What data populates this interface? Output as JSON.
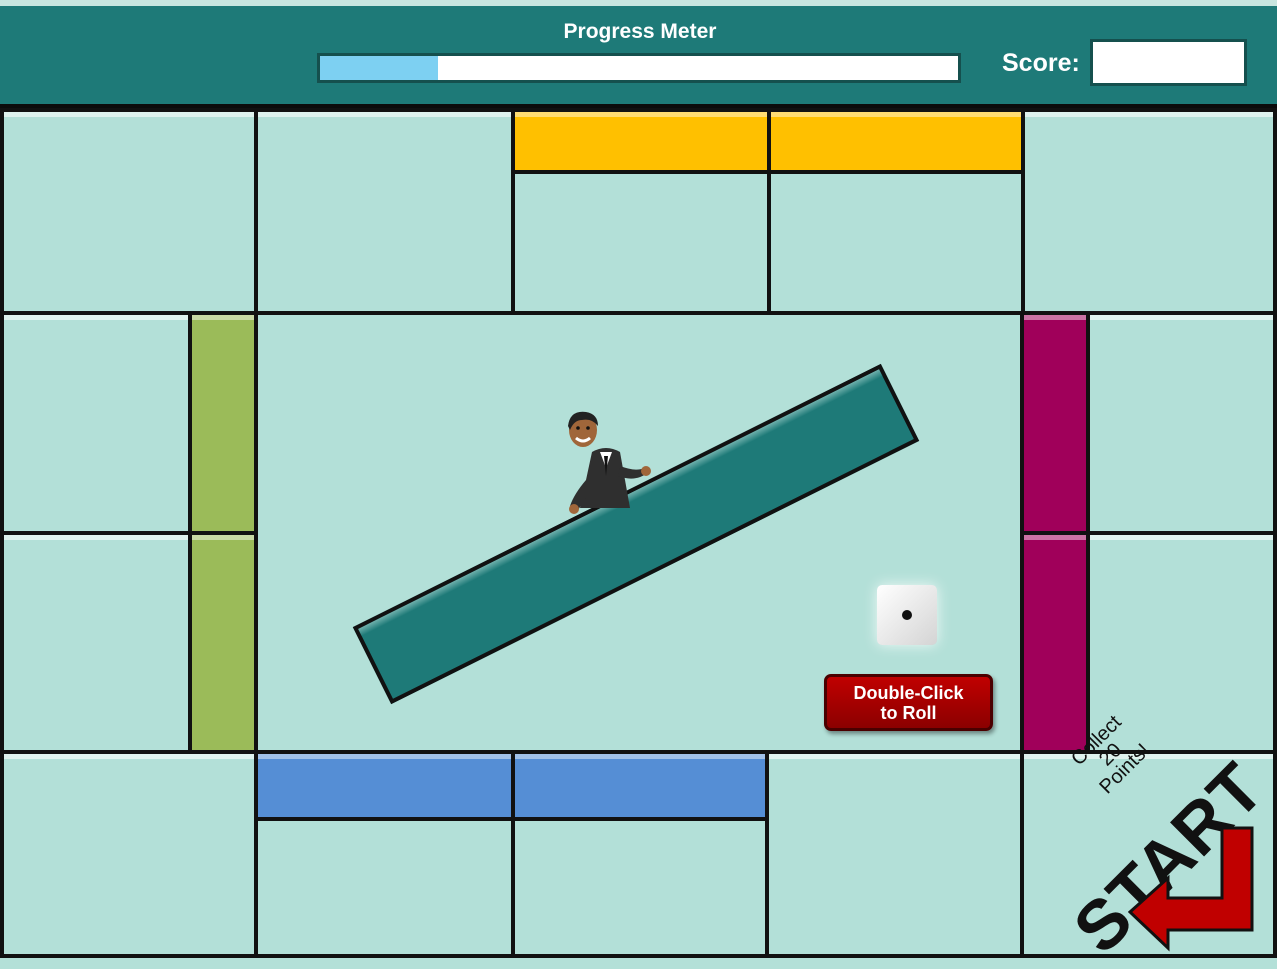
{
  "header": {
    "progress_title": "Progress Meter",
    "progress_fraction": 0.185,
    "score_label": "Score:",
    "score_value": ""
  },
  "colors": {
    "header": "#1e7a78",
    "board_cell": "#b3e0d8",
    "progress_fill": "#7dd0f2",
    "orange_property": "#ffc000",
    "green_property": "#9bbb59",
    "magenta_property": "#a0005a",
    "blue_property": "#558ed5",
    "roll_button": "#c00000",
    "start_arrow": "#c00000"
  },
  "center": {
    "character": "host-character",
    "die_value": 1,
    "roll_button_label": "Double-Click\nto Roll"
  },
  "start_corner": {
    "collect_text": "Collect 20 Points!",
    "start_label": "START",
    "arrow_icon": "start-arrow-icon"
  }
}
